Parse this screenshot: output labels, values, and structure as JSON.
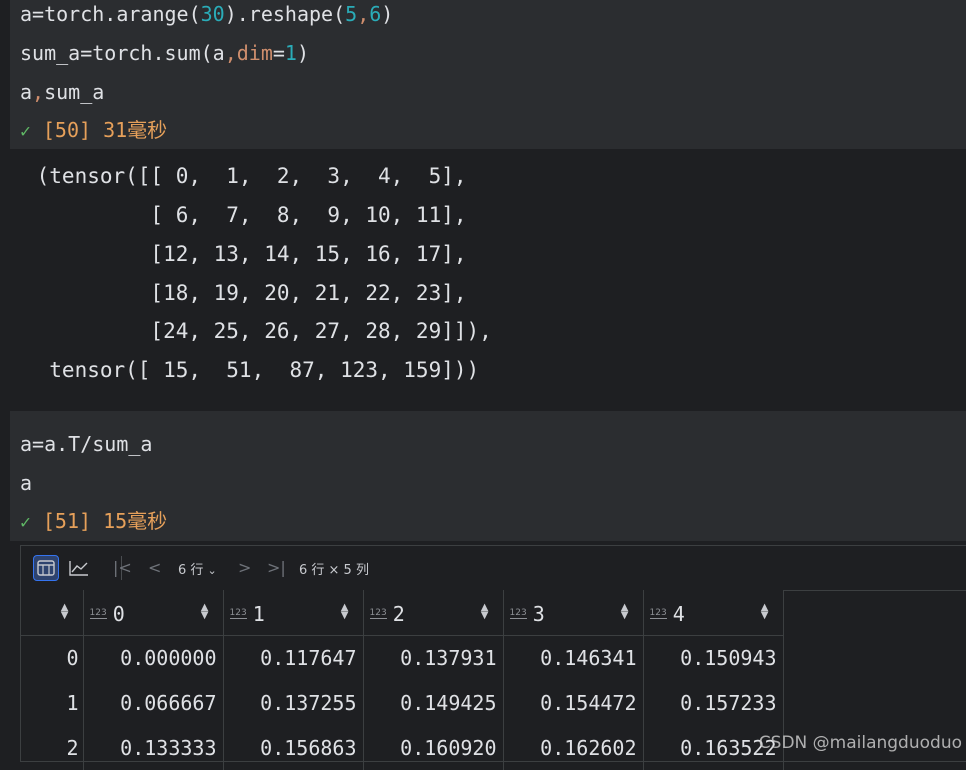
{
  "cell50": {
    "line1": {
      "a": "a=torch.arange(",
      "b": "30",
      "c": ").reshape(",
      "d": "5",
      "e": ",",
      "f": "6",
      "g": ")"
    },
    "line2": {
      "a": "sum_a=torch.sum(a",
      "b": ",",
      "c": "dim",
      "d": "=",
      "e": "1",
      "f": ")"
    },
    "line3": {
      "a": "a",
      "b": ",",
      "c": "sum_a"
    },
    "exec": {
      "check": "✓",
      "label": "[50] 31毫秒"
    }
  },
  "output50": [
    " (tensor([[ 0,  1,  2,  3,  4,  5],",
    "          [ 6,  7,  8,  9, 10, 11],",
    "          [12, 13, 14, 15, 16, 17],",
    "          [18, 19, 20, 21, 22, 23],",
    "          [24, 25, 26, 27, 28, 29]]),",
    "  tensor([ 15,  51,  87, 123, 159]))"
  ],
  "cell51": {
    "line1": "a=a.T/sum_a",
    "line2": "a",
    "exec": {
      "check": "✓",
      "label": "[51] 15毫秒"
    }
  },
  "dataframe": {
    "toolbar": {
      "table_view_icon": "table-icon",
      "chart_view_icon": "chart-icon",
      "first": "|<",
      "prev": "<",
      "rows_selector": "6 行",
      "next": ">",
      "last": ">|",
      "shape": "6 行 × 5 列"
    },
    "columns": [
      "0",
      "1",
      "2",
      "3",
      "4"
    ],
    "type_badge": "123",
    "rows": [
      {
        "index": "0",
        "values": [
          "0.000000",
          "0.117647",
          "0.137931",
          "0.146341",
          "0.150943"
        ]
      },
      {
        "index": "1",
        "values": [
          "0.066667",
          "0.137255",
          "0.149425",
          "0.154472",
          "0.157233"
        ]
      },
      {
        "index": "2",
        "values": [
          "0.133333",
          "0.156863",
          "0.160920",
          "0.162602",
          "0.163522"
        ]
      }
    ]
  },
  "watermark": "CSDN @mailangduoduo",
  "colors": {
    "number": "#2aacb8",
    "keyword": "#cf8e6d",
    "exec_time": "#e6a05a",
    "check": "#5fb865"
  }
}
